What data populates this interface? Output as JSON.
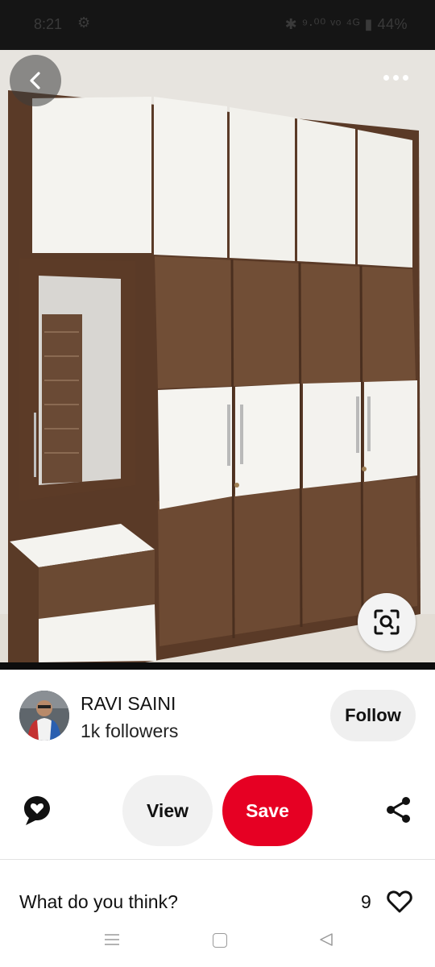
{
  "status_bar": {
    "time": "8:21",
    "right_icons": "✱ ⁹·⁰⁰ ᵛᵒ ⁴ᴳ ▮ 44%"
  },
  "pin": {
    "image_description_colors": {
      "wood": "#6b4a33",
      "white_panel": "#f4f3ef",
      "wall": "#e7e4df"
    }
  },
  "creator": {
    "name": "RAVI SAINI",
    "followers": "1k followers",
    "follow_label": "Follow"
  },
  "actions": {
    "view_label": "View",
    "save_label": "Save",
    "save_color": "#e60023"
  },
  "comments": {
    "prompt": "What do you think?",
    "like_count": "9"
  },
  "icons": {
    "back": "chevron-left-icon",
    "more": "more-horizontal-icon",
    "lens": "visual-search-icon",
    "comment": "comment-bubble-icon",
    "share": "share-icon",
    "heart": "heart-icon"
  }
}
